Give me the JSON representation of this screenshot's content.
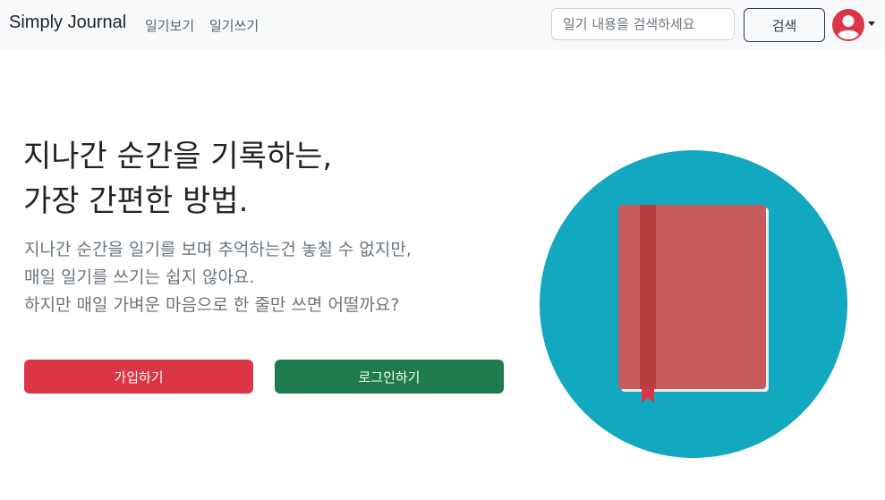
{
  "nav": {
    "brand": "Simply Journal",
    "links": [
      "일기보기",
      "일기쓰기"
    ],
    "search_placeholder": "일기 내용을 검색하세요",
    "search_button": "검색"
  },
  "hero": {
    "title_lines": [
      "지나간 순간을 기록하는,",
      "가장 간편한 방법."
    ],
    "lead_lines": [
      "지나간 순간을 일기를 보며 추억하는건 놓칠 수 없지만,",
      "매일 일기를 쓰기는 쉽지 않아요.",
      "하지만 매일 가벼운 마음으로 한 줄만 쓰면 어떨까요?"
    ],
    "signup_button": "가입하기",
    "login_button": "로그인하기"
  },
  "icons": {
    "avatar": "user-circle-icon",
    "caret": "caret-down-icon",
    "illustration": "book-illustration"
  },
  "colors": {
    "navbar_bg": "#f8f9fa",
    "signup": "#dc3545",
    "login": "#1e7b4d",
    "avatar": "#dc3545",
    "circle": "#12a8bf",
    "book": "#c65c5c",
    "book_spine": "#b73f40"
  }
}
